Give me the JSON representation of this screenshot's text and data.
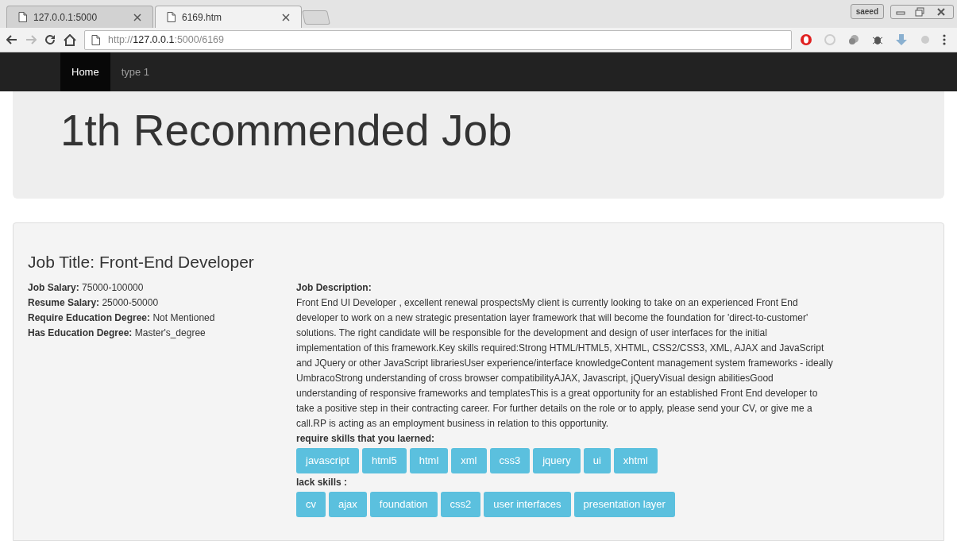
{
  "browser": {
    "tabs": [
      {
        "title": "127.0.0.1:5000",
        "selected": false
      },
      {
        "title": "6169.htm",
        "selected": true
      }
    ],
    "user_badge": "saeed",
    "address": {
      "scheme": "http://",
      "host": "127.0.0.1",
      "path": ":5000/6169"
    }
  },
  "navbar": {
    "items": [
      {
        "label": "Home",
        "selected": true
      },
      {
        "label": "type 1",
        "selected": false
      }
    ]
  },
  "jumbotron": {
    "heading": "1th Recommended Job"
  },
  "job": {
    "title": "Job Title: Front-End Developer",
    "facts": [
      {
        "label": "Job Salary:",
        "value": "75000-100000"
      },
      {
        "label": "Resume Salary:",
        "value": "25000-50000"
      },
      {
        "label": "Require Education Degree:",
        "value": "Not Mentioned"
      },
      {
        "label": "Has Education Degree:",
        "value": "Master's_degree"
      }
    ],
    "description_label": "Job Description:",
    "description": "Front End UI Developer , excellent renewal prospectsMy client is currently looking to take on an experienced Front End developer to work on a new strategic presentation layer framework that will become the foundation for 'direct-to-customer' solutions. The right candidate will be responsible for the development and design of user interfaces for the initial implementation of this framework.Key skills required:Strong HTML/HTML5, XHTML, CSS2/CSS3, XML, AJAX and JavaScript and JQuery or other JavaScript librariesUser experience/interface knowledgeContent management system frameworks - ideally UmbracoStrong understanding of cross browser compatibilityAJAX, Javascript, jQueryVisual design abilitiesGood understanding of responsive frameworks and templatesThis is a great opportunity for an established Front End developer to take a positive step in their contracting career. For further details on the role or to apply, please send your CV, or give me a call.RP is acting as an employment business in relation to this opportunity.",
    "learned_label": "require skills that you laerned:",
    "learned_skills": [
      "javascript",
      "html5",
      "html",
      "xml",
      "css3",
      "jquery",
      "ui",
      "xhtml"
    ],
    "lack_label": "lack skills :",
    "lack_skills": [
      "cv",
      "ajax",
      "foundation",
      "css2",
      "user interfaces",
      "presentation layer"
    ]
  }
}
